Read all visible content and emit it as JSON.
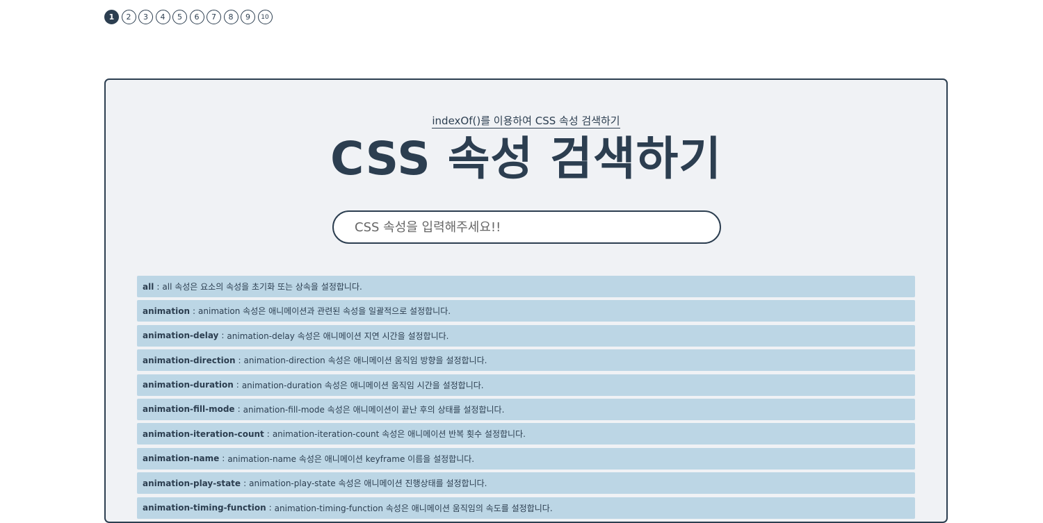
{
  "pagination": {
    "pages": [
      "1",
      "2",
      "3",
      "4",
      "5",
      "6",
      "7",
      "8",
      "9",
      "10"
    ],
    "active": "1"
  },
  "header": {
    "subtitle": "indexOf()를 이용하여 CSS 속성 검색하기",
    "title": "CSS 속성 검색하기"
  },
  "search": {
    "placeholder": "CSS 속성을 입력해주세요!!",
    "value": ""
  },
  "separator": ":",
  "properties": [
    {
      "name": "all",
      "desc": "all 속성은 요소의 속성을 초기화 또는 상속을 설정합니다."
    },
    {
      "name": "animation",
      "desc": "animation 속성은 애니메이션과 관련된 속성을 일괄적으로 설정합니다."
    },
    {
      "name": "animation-delay",
      "desc": "animation-delay 속성은 애니메이션 지연 시간을 설정합니다."
    },
    {
      "name": "animation-direction",
      "desc": "animation-direction 속성은 애니메이션 움직임 방향을 설정합니다."
    },
    {
      "name": "animation-duration",
      "desc": "animation-duration 속성은 애니메이션 움직임 시간을 설정합니다."
    },
    {
      "name": "animation-fill-mode",
      "desc": "animation-fill-mode 속성은 애니메이션이 끝난 후의 상태를 설정합니다."
    },
    {
      "name": "animation-iteration-count",
      "desc": "animation-iteration-count 속성은 애니메이션 반복 횟수 설정합니다."
    },
    {
      "name": "animation-name",
      "desc": "animation-name 속성은 애니메이션 keyframe 이름을 설정합니다."
    },
    {
      "name": "animation-play-state",
      "desc": "animation-play-state 속성은 애니메이션 진행상태를 설정합니다."
    },
    {
      "name": "animation-timing-function",
      "desc": "animation-timing-function 속성은 애니메이션 움직임의 속도를 설정합니다."
    }
  ],
  "colors": {
    "primary": "#2c3e50",
    "panel_bg": "#f0f2f5",
    "item_bg": "#bcd6e5"
  }
}
